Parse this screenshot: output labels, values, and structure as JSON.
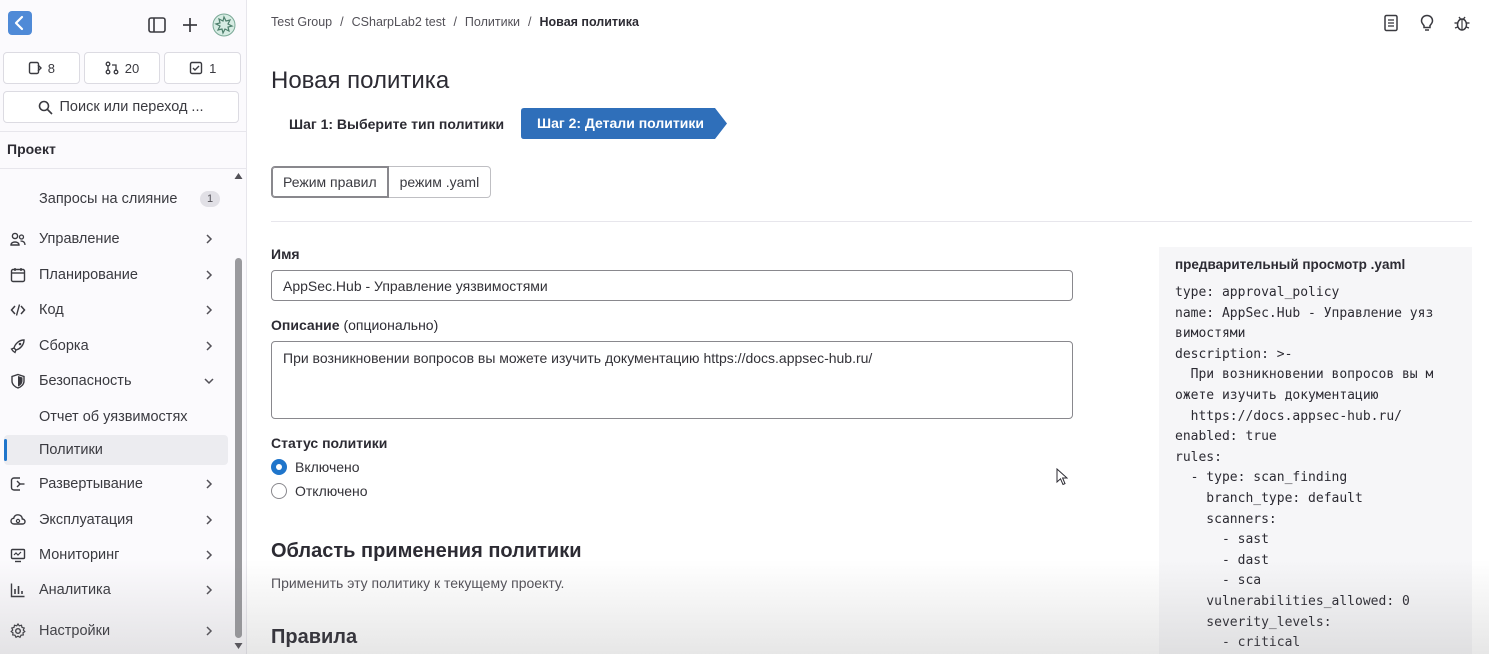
{
  "sidebar": {
    "counters": [
      {
        "icon": "issues-icon",
        "count": "8"
      },
      {
        "icon": "merge-request-icon",
        "count": "20"
      },
      {
        "icon": "todo-icon",
        "count": "1"
      }
    ],
    "search_label": "Поиск или переход ...",
    "project_heading": "Проект",
    "merge_requests_item": {
      "label": "Запросы на слияние",
      "badge": "1"
    },
    "items": [
      {
        "label": "Управление",
        "icon": "users-icon"
      },
      {
        "label": "Планирование",
        "icon": "calendar-icon"
      },
      {
        "label": "Код",
        "icon": "code-icon"
      },
      {
        "label": "Сборка",
        "icon": "rocket-icon"
      },
      {
        "label": "Безопасность",
        "icon": "shield-icon"
      },
      {
        "label": "Отчет об уязвимостях"
      },
      {
        "label": "Политики"
      },
      {
        "label": "Развертывание",
        "icon": "deployments-icon"
      },
      {
        "label": "Эксплуатация",
        "icon": "cloud-icon"
      },
      {
        "label": "Мониторинг",
        "icon": "monitor-icon"
      },
      {
        "label": "Аналитика",
        "icon": "chart-icon"
      },
      {
        "label": "Настройки",
        "icon": "settings-icon"
      }
    ]
  },
  "breadcrumb": {
    "items": [
      "Test Group",
      "CSharpLab2 test",
      "Политики"
    ],
    "separator": "/",
    "current": "Новая политика"
  },
  "page": {
    "title": "Новая политика",
    "step1": "Шаг 1: Выберите тип политики",
    "step2": "Шаг 2: Детали политики",
    "mode_rules": "Режим правил",
    "mode_yaml": "режим .yaml"
  },
  "form": {
    "name_label": "Имя",
    "name_value": "AppSec.Hub - Управление уязвимостями",
    "desc_label": "Описание",
    "desc_optional": "(опционально)",
    "desc_value": "При возникновении вопросов вы можете изучить документацию https://docs.appsec-hub.ru/",
    "status_label": "Статус политики",
    "status_on": "Включено",
    "status_off": "Отключено",
    "status_selected": "Включено",
    "scope_heading": "Область применения политики",
    "scope_text": "Применить эту политику к текущему проекту.",
    "rules_heading": "Правила"
  },
  "yaml": {
    "title": "предварительный просмотр .yaml",
    "code": "type: approval_policy\nname: AppSec.Hub - Управление уяз\nвимостями\ndescription: >-\n  При возникновении вопросов вы м\nожете изучить документацию\n  https://docs.appsec-hub.ru/\nenabled: true\nrules:\n  - type: scan_finding\n    branch_type: default\n    scanners:\n      - sast\n      - dast\n      - sca\n    vulnerabilities_allowed: 0\n    severity_levels:\n      - critical"
  },
  "colors": {
    "accent": "#1f75cb",
    "logo": "#4f8ad7",
    "step_active": "#2f6fba"
  }
}
